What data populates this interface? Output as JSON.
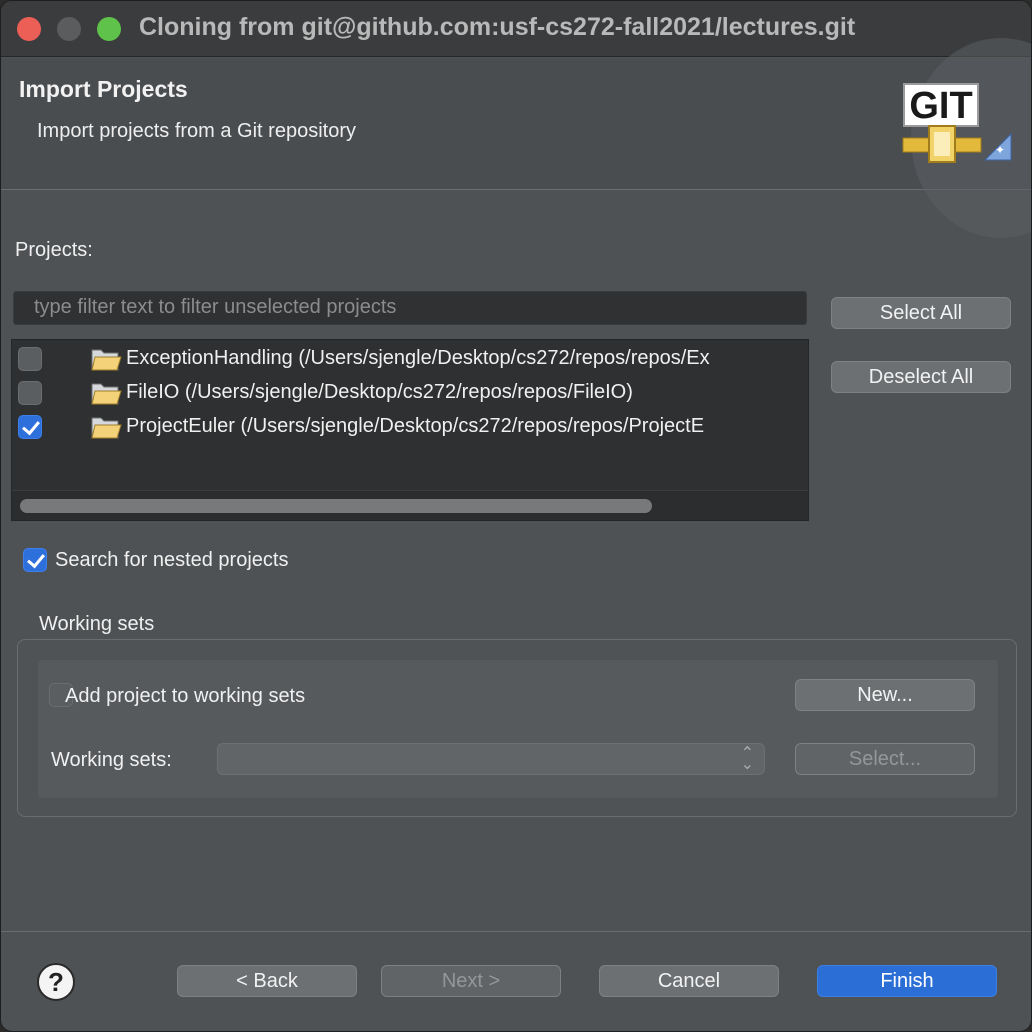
{
  "window": {
    "title": "Cloning from git@github.com:usf-cs272-fall2021/lectures.git"
  },
  "banner": {
    "title": "Import Projects",
    "description": "Import projects from a Git repository",
    "logo_text": "GIT"
  },
  "projects": {
    "label": "Projects:",
    "filter_placeholder": "type filter text to filter unselected projects",
    "items": [
      {
        "label": "ExceptionHandling (/Users/sjengle/Desktop/cs272/repos/repos/Ex",
        "checked": false
      },
      {
        "label": "FileIO (/Users/sjengle/Desktop/cs272/repos/repos/FileIO)",
        "checked": false
      },
      {
        "label": "ProjectEuler (/Users/sjengle/Desktop/cs272/repos/repos/ProjectE",
        "checked": true
      }
    ],
    "select_all": "Select All",
    "deselect_all": "Deselect All"
  },
  "nested": {
    "label": "Search for nested projects",
    "checked": true
  },
  "working_sets": {
    "caption": "Working sets",
    "add_label": "Add project to working sets",
    "add_checked": false,
    "new_button": "New...",
    "sets_label": "Working sets:",
    "select_button": "Select..."
  },
  "footer": {
    "help": "?",
    "back": "< Back",
    "next": "Next >",
    "cancel": "Cancel",
    "finish": "Finish"
  },
  "colors": {
    "primary_button": "#2b6fd6",
    "checkbox_checked": "#2d6fdb",
    "close": "#ec5f57",
    "zoom": "#5fc24a"
  }
}
